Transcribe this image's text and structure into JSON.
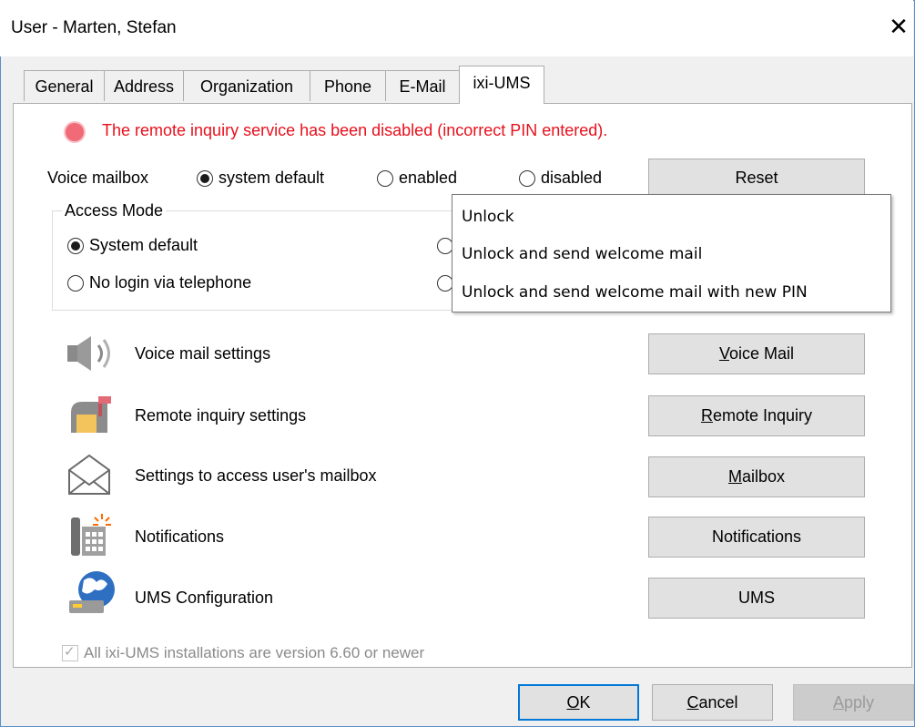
{
  "window": {
    "title": "User - Marten, Stefan",
    "close_glyph": "✕"
  },
  "tabs": [
    {
      "label": "General"
    },
    {
      "label": "Address"
    },
    {
      "label": "Organization"
    },
    {
      "label": "Phone"
    },
    {
      "label": "E-Mail"
    },
    {
      "label": "ixi-UMS",
      "active": true
    }
  ],
  "warning": {
    "text": "The remote inquiry service has been disabled (incorrect PIN entered).",
    "color": "#e8101c"
  },
  "voice_mailbox": {
    "label": "Voice mailbox",
    "options": [
      {
        "label": "system default",
        "selected": true
      },
      {
        "label": "enabled",
        "selected": false
      },
      {
        "label": "disabled",
        "selected": false
      }
    ],
    "reset_label": "Reset"
  },
  "access_mode": {
    "title": "Access Mode",
    "options": [
      {
        "label": "System default",
        "selected": true
      },
      {
        "label": "No login via telephone",
        "selected": false
      }
    ]
  },
  "reset_menu": {
    "items": [
      "Unlock",
      "Unlock and send welcome mail",
      "Unlock and send welcome mail with new PIN"
    ]
  },
  "settings_rows": [
    {
      "icon": "speaker-icon",
      "label": "Voice mail settings",
      "button_pre": "",
      "button_mnemonic": "V",
      "button_post": "oice Mail"
    },
    {
      "icon": "mailbox-icon",
      "label": "Remote inquiry settings",
      "button_pre": "",
      "button_mnemonic": "R",
      "button_post": "emote Inquiry"
    },
    {
      "icon": "envelope-icon",
      "label": "Settings to access user's mailbox",
      "button_pre": "",
      "button_mnemonic": "M",
      "button_post": "ailbox"
    },
    {
      "icon": "phone-icon",
      "label": "Notifications",
      "button_pre": "",
      "button_mnemonic": "",
      "button_post": "Notifications"
    },
    {
      "icon": "globe-icon",
      "label": "UMS Configuration",
      "button_pre": "",
      "button_mnemonic": "",
      "button_post": "UMS"
    }
  ],
  "version_check": {
    "label": "All ixi-UMS installations are version 6.60 or newer",
    "checked": true,
    "enabled": false
  },
  "footer": {
    "ok_mnemonic": "O",
    "ok_post": "K",
    "cancel_mnemonic": "C",
    "cancel_post": "ancel",
    "apply_mnemonic": "A",
    "apply_post": "pply"
  }
}
